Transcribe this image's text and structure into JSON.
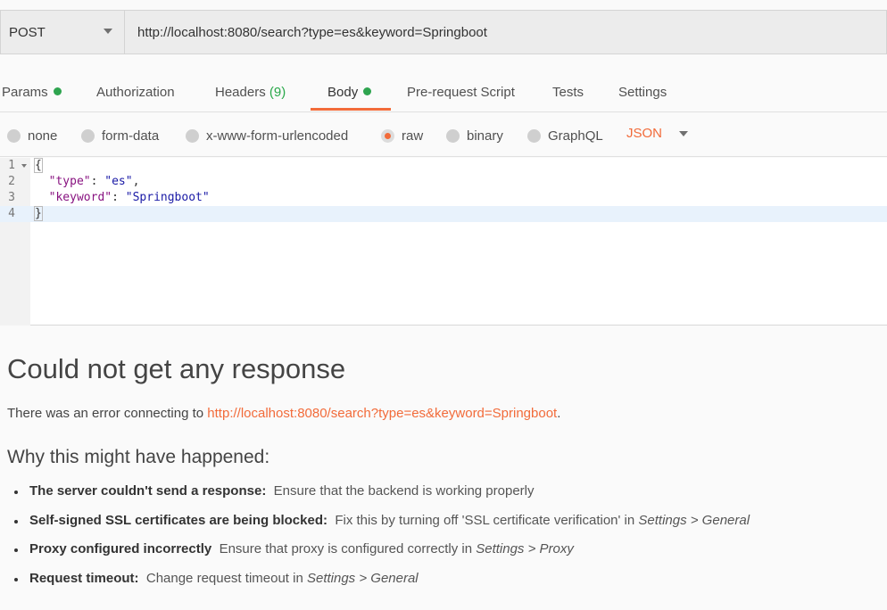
{
  "request": {
    "method": "POST",
    "url": "http://localhost:8080/search?type=es&keyword=Springboot"
  },
  "tabs": [
    {
      "label": "Params",
      "dot": true
    },
    {
      "label": "Authorization"
    },
    {
      "label": "Headers",
      "count": "(9)"
    },
    {
      "label": "Body",
      "dot": true,
      "active": true
    },
    {
      "label": "Pre-request Script"
    },
    {
      "label": "Tests"
    },
    {
      "label": "Settings"
    }
  ],
  "body_types": {
    "options": [
      "none",
      "form-data",
      "x-www-form-urlencoded",
      "raw",
      "binary",
      "GraphQL"
    ],
    "selected": "raw",
    "format": "JSON"
  },
  "editor": {
    "line_numbers": [
      "1",
      "2",
      "3",
      "4"
    ],
    "lines": {
      "l1": "{",
      "l2_key": "\"type\"",
      "l2_val": "\"es\"",
      "l3_key": "\"keyword\"",
      "l3_val": "\"Springboot\"",
      "l4": "}"
    },
    "current_line": "4"
  },
  "response": {
    "title": "Could not get any response",
    "message_prefix": "There was an error connecting to ",
    "message_link": "http://localhost:8080/search?type=es&keyword=Springboot",
    "message_suffix": ".",
    "why_heading": "Why this might have happened:",
    "reasons": [
      {
        "bold": "The server couldn't send a response:",
        "text": "Ensure that the backend is working properly"
      },
      {
        "bold": "Self-signed SSL certificates are being blocked:",
        "text": "Fix this by turning off 'SSL certificate verification' in ",
        "italic": "Settings > General"
      },
      {
        "bold": "Proxy configured incorrectly",
        "text": "Ensure that proxy is configured correctly in ",
        "italic": "Settings > Proxy"
      },
      {
        "bold": "Request timeout:",
        "text": "Change request timeout in ",
        "italic": "Settings > General"
      }
    ]
  },
  "colors": {
    "accent": "#f26b3a",
    "status_dot": "#2ea44f",
    "json_key": "#881280",
    "json_string": "#1a1aa6"
  }
}
